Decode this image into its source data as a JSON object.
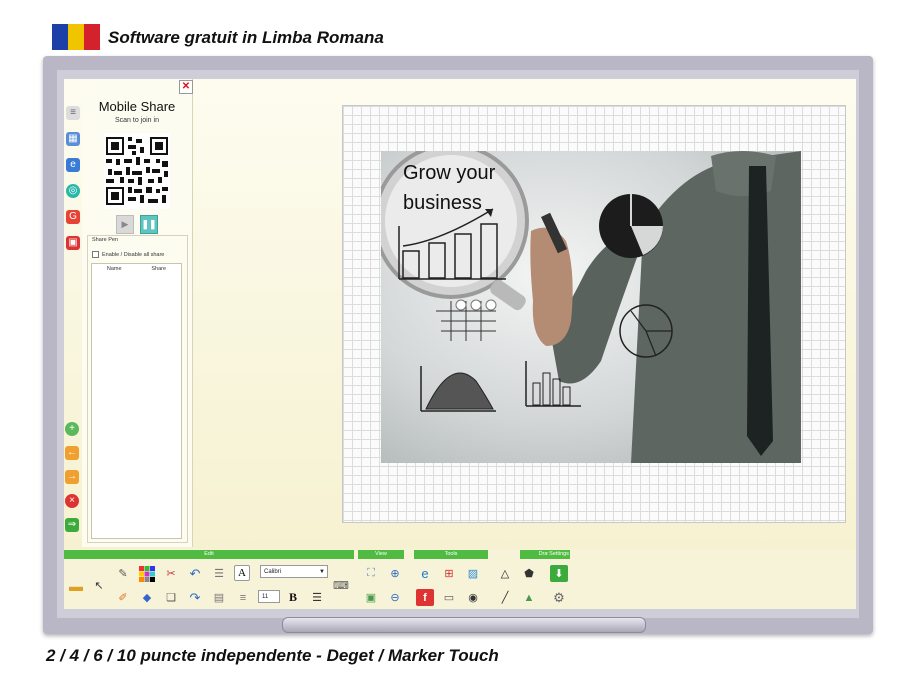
{
  "header": {
    "title": "Software gratuit in Limba Romana",
    "flag_colors": [
      "#1d3fa8",
      "#f1c400",
      "#d3222c"
    ]
  },
  "footer": {
    "text": "2 / 4 / 6 / 10 puncte independente - Deget / Marker Touch"
  },
  "mobile_share": {
    "title": "Mobile Share",
    "subtitle": "Scan to join in",
    "share_pen_label": "Share Pen",
    "enable_label": "Enable / Disable all share",
    "list_columns": [
      "Name",
      "Share"
    ],
    "close_icon": "close-icon"
  },
  "canvas": {
    "magnifier_text": [
      "Grow your",
      "business"
    ]
  },
  "toolbar": {
    "groups": [
      "Edit",
      "View",
      "Tools",
      "Draw",
      "Settings"
    ],
    "font_name": "Calibri",
    "font_size": "11",
    "bold_label": "B",
    "text_tool_label": "A"
  },
  "colors": {
    "accent_green": "#4fbb43",
    "board_frame": "#b9b6c6",
    "screen_bg": "#f8f4d8"
  }
}
